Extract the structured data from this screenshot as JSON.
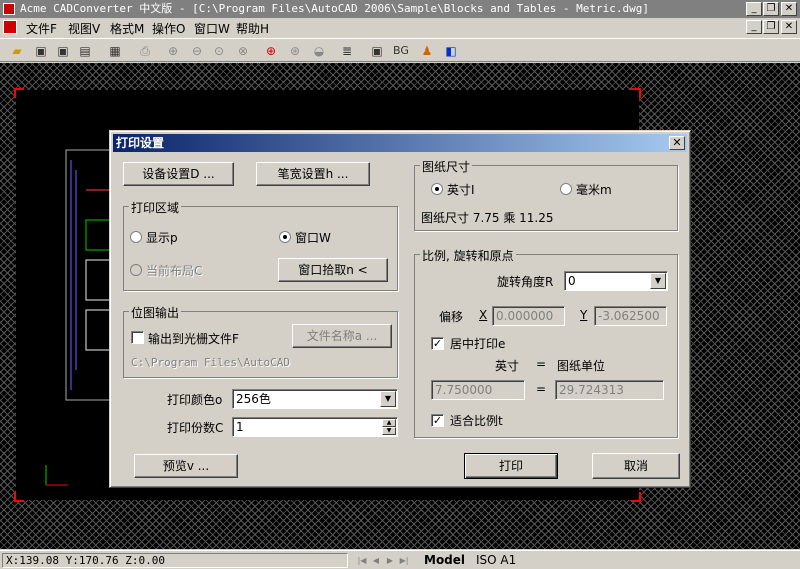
{
  "window": {
    "title": "Acme CADConverter 中文版 - [C:\\Program Files\\AutoCAD 2006\\Sample\\Blocks and Tables - Metric.dwg]",
    "minimize_icon": "minimize-icon",
    "restore_icon": "restore-icon",
    "close_icon": "close-icon"
  },
  "menu": {
    "items": [
      {
        "label": "文件F"
      },
      {
        "label": "视图V"
      },
      {
        "label": "格式M"
      },
      {
        "label": "操作O"
      },
      {
        "label": "窗口W"
      },
      {
        "label": "帮助H"
      }
    ]
  },
  "toolbar": {
    "bg_label": "BG"
  },
  "status": {
    "coords": "X:139.08 Y:170.76 Z:0.00",
    "tabs": [
      {
        "label": "Model"
      },
      {
        "label": "ISO A1"
      }
    ]
  },
  "dialog": {
    "title": "打印设置",
    "device_button": "设备设置D ...",
    "pen_button": "笔宽设置h ...",
    "print_area": {
      "label": "打印区域",
      "display": "显示p",
      "window": "窗口W",
      "current_layout": "当前布局C",
      "window_pick": "窗口拾取n <"
    },
    "bitmap": {
      "label": "位图输出",
      "output_to_raster": "输出到光栅文件F",
      "filename_button": "文件名称a ...",
      "path": "C:\\Program Files\\AutoCAD"
    },
    "print_color": {
      "label": "打印颜色o",
      "value": "256色"
    },
    "copies": {
      "label": "打印份数C",
      "value": "1"
    },
    "preview_button": "预览v ...",
    "print_button": "打印",
    "cancel_button": "取消",
    "paper_size": {
      "label": "图纸尺寸",
      "inch": "英寸I",
      "mm": "毫米m",
      "text": "图纸尺寸 7.75 乘 11.25"
    },
    "scale": {
      "label": "比例, 旋转和原点",
      "rotation_label": "旋转角度R",
      "rotation_value": "0",
      "offset_label": "偏移",
      "x_label": "X",
      "x_value": "0.000000",
      "y_label": "Y",
      "y_value": "-3.062500",
      "center_print": "居中打印e",
      "inch_label": "英寸",
      "eq": "=",
      "units_label": "图纸单位",
      "inch_value": "7.750000",
      "units_value": "29.724313",
      "fit_scale": "适合比例t"
    }
  }
}
